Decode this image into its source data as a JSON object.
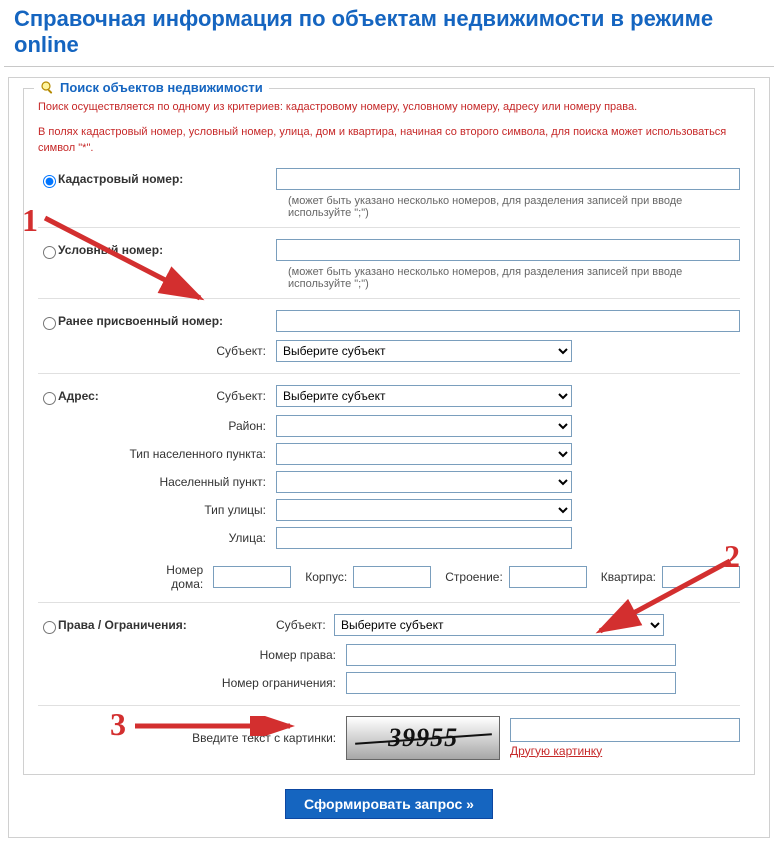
{
  "page_title": "Справочная информация по объектам недвижимости в режиме online",
  "legend": "Поиск объектов недвижимости",
  "hints": {
    "line1": "Поиск осуществляется по одному из критериев: кадастровому номеру, условному номеру, адресу или номеру права.",
    "line2": "В полях кадастровый номер, условный номер, улица, дом и квартира, начиная со второго символа, для поиска может использоваться символ \"*\"."
  },
  "criteria": {
    "cadastral": {
      "label": "Кадастровый номер:",
      "note": "(может быть указано несколько номеров, для разделения записей при вводе используйте \";\")"
    },
    "conditional": {
      "label": "Условный номер:",
      "note": "(может быть указано несколько номеров, для разделения записей при вводе используйте \";\")"
    },
    "prev": {
      "label": "Ранее присвоенный номер:",
      "subject_label": "Субъект:",
      "subject_placeholder": "Выберите субъект"
    },
    "address": {
      "label": "Адрес:",
      "subject_label": "Субъект:",
      "subject_placeholder": "Выберите субъект",
      "district_label": "Район:",
      "settlement_type_label": "Тип населенного пункта:",
      "settlement_label": "Населенный пункт:",
      "street_type_label": "Тип улицы:",
      "street_label": "Улица:",
      "house_label": "Номер дома:",
      "korpus_label": "Корпус:",
      "building_label": "Строение:",
      "flat_label": "Квартира:"
    },
    "rights": {
      "label": "Права / Ограничения:",
      "subject_label": "Субъект:",
      "subject_placeholder": "Выберите субъект",
      "right_no_label": "Номер права:",
      "restrict_no_label": "Номер ограничения:"
    }
  },
  "captcha": {
    "label": "Введите текст с картинки:",
    "value": "39955",
    "refresh": "Другую картинку"
  },
  "submit": "Сформировать запрос »",
  "annotations": {
    "n1": "1",
    "n2": "2",
    "n3": "3"
  }
}
